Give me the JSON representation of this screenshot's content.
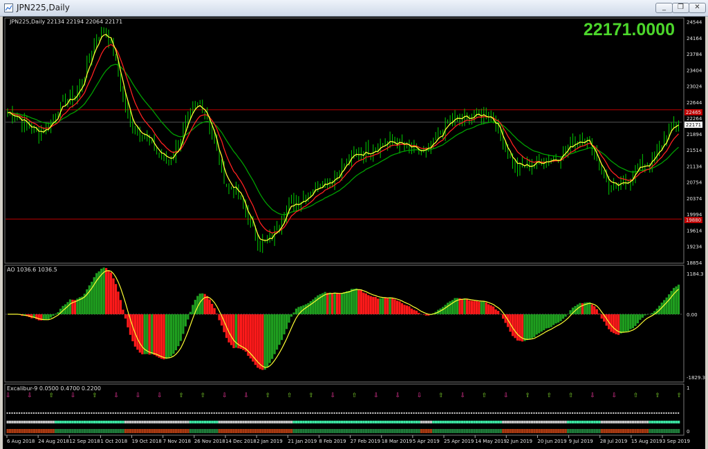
{
  "window": {
    "title": "JPN225,Daily",
    "minimize_label": "_",
    "restore_label": "❐",
    "close_label": "✕"
  },
  "main_chart": {
    "header": "JPN225,Daily  22134 22194 22064 22171",
    "last_price": "22171.0000",
    "price_ticks": [
      "24544",
      "24164",
      "23784",
      "23404",
      "23024",
      "22644",
      "22264",
      "21894",
      "21514",
      "21134",
      "20754",
      "20374",
      "19994",
      "19614",
      "19234",
      "18854"
    ],
    "upper_level_tag": "22465",
    "current_price_tag": "22171",
    "lower_level_tag": "19880",
    "colors": {
      "candle": "#00d000",
      "fast_ma": "#ffff33",
      "mid_ma": "#ff2020",
      "slow_ma": "#00a000",
      "level_line": "#c00000"
    }
  },
  "ao_panel": {
    "header": "AO 1036.6 1036.5",
    "ticks": [
      "1184.3",
      "0.00",
      "-1829.3"
    ]
  },
  "excalibur_panel": {
    "header": "Excalibur-9 0.0500 0.4700 0.2200",
    "ticks": [
      "1",
      "0"
    ]
  },
  "date_labels": [
    "6 Aug 2018",
    "24 Aug 2018",
    "12 Sep 2018",
    "1 Oct 2018",
    "19 Oct 2018",
    "7 Nov 2018",
    "26 Nov 2018",
    "14 Dec 2018",
    "2 Jan 2019",
    "21 Jan 2019",
    "8 Feb 2019",
    "27 Feb 2019",
    "18 Mar 2019",
    "5 Apr 2019",
    "25 Apr 2019",
    "14 May 2019",
    "2 Jun 2019",
    "20 Jun 2019",
    "9 Jul 2019",
    "28 Jul 2019",
    "15 Aug 2019",
    "3 Sep 2019"
  ],
  "chart_data": {
    "type": "candlestick",
    "title": "JPN225,Daily",
    "approx_close_series": [
      22400,
      21950,
      22750,
      24350,
      22000,
      21300,
      22600,
      20600,
      19300,
      20300,
      20800,
      21450,
      21700,
      21450,
      22250,
      22350,
      21100,
      21300,
      21800,
      20600,
      21200,
      22171
    ],
    "x_labels_for_series": [
      "6 Aug 2018",
      "24 Aug 2018",
      "12 Sep 2018",
      "1 Oct 2018",
      "19 Oct 2018",
      "7 Nov 2018",
      "26 Nov 2018",
      "14 Dec 2018",
      "2 Jan 2019",
      "21 Jan 2019",
      "8 Feb 2019",
      "27 Feb 2019",
      "18 Mar 2019",
      "5 Apr 2019",
      "25 Apr 2019",
      "14 May 2019",
      "2 Jun 2019",
      "20 Jun 2019",
      "9 Jul 2019",
      "28 Jul 2019",
      "15 Aug 2019",
      "3 Sep 2019"
    ],
    "ylim": [
      18854,
      24700
    ],
    "ao_ylim": [
      -1829.3,
      1184.3
    ],
    "horizontal_levels": [
      22465,
      19880
    ]
  }
}
